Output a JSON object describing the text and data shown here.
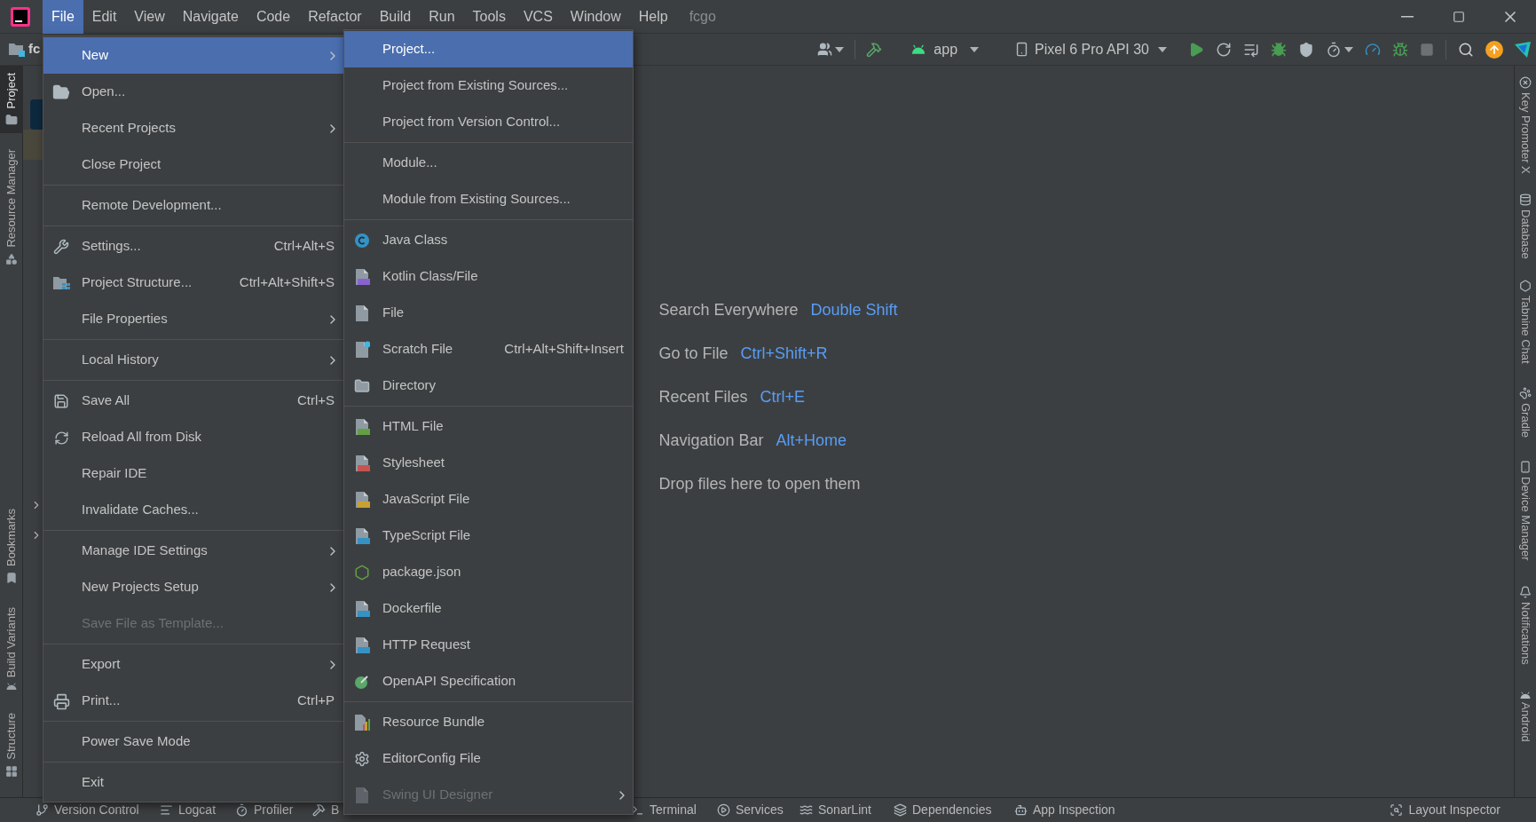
{
  "window_title": "fcgo",
  "menu_bar": [
    {
      "label": "File",
      "selected": true
    },
    {
      "label": "Edit",
      "selected": false
    },
    {
      "label": "View",
      "selected": false
    },
    {
      "label": "Navigate",
      "selected": false
    },
    {
      "label": "Code",
      "selected": false
    },
    {
      "label": "Refactor",
      "selected": false
    },
    {
      "label": "Build",
      "selected": false
    },
    {
      "label": "Run",
      "selected": false
    },
    {
      "label": "Tools",
      "selected": false
    },
    {
      "label": "VCS",
      "selected": false
    },
    {
      "label": "Window",
      "selected": false
    },
    {
      "label": "Help",
      "selected": false
    }
  ],
  "toolbar": {
    "breadcrumb": "fc",
    "run_config": "app",
    "device": "Pixel 6 Pro API 30"
  },
  "left_tool_strip_top": [
    {
      "label": "Project",
      "selected": true
    },
    {
      "label": "Resource Manager",
      "selected": false
    }
  ],
  "left_tool_strip_bottom": [
    {
      "label": "Bookmarks",
      "selected": false
    },
    {
      "label": "Build Variants",
      "selected": false
    },
    {
      "label": "Structure",
      "selected": false
    }
  ],
  "right_tool_strip": [
    {
      "label": "Key Promoter X"
    },
    {
      "label": "Database"
    },
    {
      "label": "Tabnine Chat"
    },
    {
      "label": "Gradle"
    },
    {
      "label": "Device Manager"
    },
    {
      "label": "Notifications"
    },
    {
      "label": "Android"
    }
  ],
  "editor_hints": [
    {
      "label": "Search Everywhere",
      "shortcut": "Double Shift"
    },
    {
      "label": "Go to File",
      "shortcut": "Ctrl+Shift+R"
    },
    {
      "label": "Recent Files",
      "shortcut": "Ctrl+E"
    },
    {
      "label": "Navigation Bar",
      "shortcut": "Alt+Home"
    },
    {
      "label": "Drop files here to open them"
    }
  ],
  "file_menu": {
    "sections": [
      {
        "items": [
          {
            "label": "New",
            "selected": true,
            "disabled": false,
            "submenu": true
          },
          {
            "label": "Open...",
            "selected": false,
            "disabled": false,
            "submenu": false
          },
          {
            "label": "Recent Projects",
            "selected": false,
            "disabled": false,
            "submenu": true
          },
          {
            "label": "Close Project",
            "selected": false,
            "disabled": false,
            "submenu": false
          }
        ]
      },
      {
        "items": [
          {
            "label": "Remote Development...",
            "selected": false,
            "disabled": false,
            "submenu": false
          }
        ]
      },
      {
        "items": [
          {
            "label": "Settings...",
            "shortcut": "Ctrl+Alt+S",
            "selected": false,
            "disabled": false,
            "submenu": false
          },
          {
            "label": "Project Structure...",
            "shortcut": "Ctrl+Alt+Shift+S",
            "selected": false,
            "disabled": false,
            "submenu": false
          },
          {
            "label": "File Properties",
            "selected": false,
            "disabled": false,
            "submenu": true
          }
        ]
      },
      {
        "items": [
          {
            "label": "Local History",
            "selected": false,
            "disabled": false,
            "submenu": true
          }
        ]
      },
      {
        "items": [
          {
            "label": "Save All",
            "shortcut": "Ctrl+S",
            "selected": false,
            "disabled": false,
            "submenu": false
          },
          {
            "label": "Reload All from Disk",
            "selected": false,
            "disabled": false,
            "submenu": false
          },
          {
            "label": "Repair IDE",
            "selected": false,
            "disabled": false,
            "submenu": false
          },
          {
            "label": "Invalidate Caches...",
            "selected": false,
            "disabled": false,
            "submenu": false
          }
        ]
      },
      {
        "items": [
          {
            "label": "Manage IDE Settings",
            "selected": false,
            "disabled": false,
            "submenu": true
          },
          {
            "label": "New Projects Setup",
            "selected": false,
            "disabled": false,
            "submenu": true
          },
          {
            "label": "Save File as Template...",
            "selected": false,
            "disabled": true,
            "submenu": false
          }
        ]
      },
      {
        "items": [
          {
            "label": "Export",
            "selected": false,
            "disabled": false,
            "submenu": true
          },
          {
            "label": "Print...",
            "shortcut": "Ctrl+P",
            "selected": false,
            "disabled": false,
            "submenu": false
          }
        ]
      },
      {
        "items": [
          {
            "label": "Power Save Mode",
            "selected": false,
            "disabled": false,
            "submenu": false
          }
        ]
      },
      {
        "items": [
          {
            "label": "Exit",
            "selected": false,
            "disabled": false,
            "submenu": false
          }
        ]
      }
    ]
  },
  "new_submenu": {
    "sections": [
      {
        "items": [
          {
            "label": "Project...",
            "selected": true,
            "disabled": false,
            "submenu": false
          },
          {
            "label": "Project from Existing Sources...",
            "selected": false,
            "disabled": false,
            "submenu": false
          },
          {
            "label": "Project from Version Control...",
            "selected": false,
            "disabled": false,
            "submenu": false
          }
        ]
      },
      {
        "items": [
          {
            "label": "Module...",
            "selected": false,
            "disabled": false,
            "submenu": false
          },
          {
            "label": "Module from Existing Sources...",
            "selected": false,
            "disabled": false,
            "submenu": false
          }
        ]
      },
      {
        "items": [
          {
            "label": "Java Class",
            "selected": false,
            "disabled": false,
            "submenu": false
          },
          {
            "label": "Kotlin Class/File",
            "selected": false,
            "disabled": false,
            "submenu": false
          },
          {
            "label": "File",
            "selected": false,
            "disabled": false,
            "submenu": false
          },
          {
            "label": "Scratch File",
            "shortcut": "Ctrl+Alt+Shift+Insert",
            "selected": false,
            "disabled": false,
            "submenu": false
          },
          {
            "label": "Directory",
            "selected": false,
            "disabled": false,
            "submenu": false
          }
        ]
      },
      {
        "items": [
          {
            "label": "HTML File",
            "selected": false,
            "disabled": false,
            "submenu": false
          },
          {
            "label": "Stylesheet",
            "selected": false,
            "disabled": false,
            "submenu": false
          },
          {
            "label": "JavaScript File",
            "selected": false,
            "disabled": false,
            "submenu": false
          },
          {
            "label": "TypeScript File",
            "selected": false,
            "disabled": false,
            "submenu": false
          },
          {
            "label": "package.json",
            "selected": false,
            "disabled": false,
            "submenu": false
          },
          {
            "label": "Dockerfile",
            "selected": false,
            "disabled": false,
            "submenu": false
          },
          {
            "label": "HTTP Request",
            "selected": false,
            "disabled": false,
            "submenu": false
          },
          {
            "label": "OpenAPI Specification",
            "selected": false,
            "disabled": false,
            "submenu": false
          }
        ]
      },
      {
        "items": [
          {
            "label": "Resource Bundle",
            "selected": false,
            "disabled": false,
            "submenu": false
          },
          {
            "label": "EditorConfig File",
            "selected": false,
            "disabled": false,
            "submenu": false
          },
          {
            "label": "Swing UI Designer",
            "selected": false,
            "disabled": true,
            "submenu": true
          }
        ]
      }
    ]
  },
  "bottom_tool_strip_left": [
    {
      "label": "Version Control"
    },
    {
      "label": "Logcat"
    },
    {
      "label": "Profiler"
    },
    {
      "label": "B"
    },
    {
      "label": "Terminal"
    },
    {
      "label": "Services"
    },
    {
      "label": "SonarLint"
    },
    {
      "label": "Dependencies"
    },
    {
      "label": "App Inspection"
    }
  ],
  "bottom_tool_strip_right": [
    {
      "label": "Layout Inspector"
    }
  ]
}
